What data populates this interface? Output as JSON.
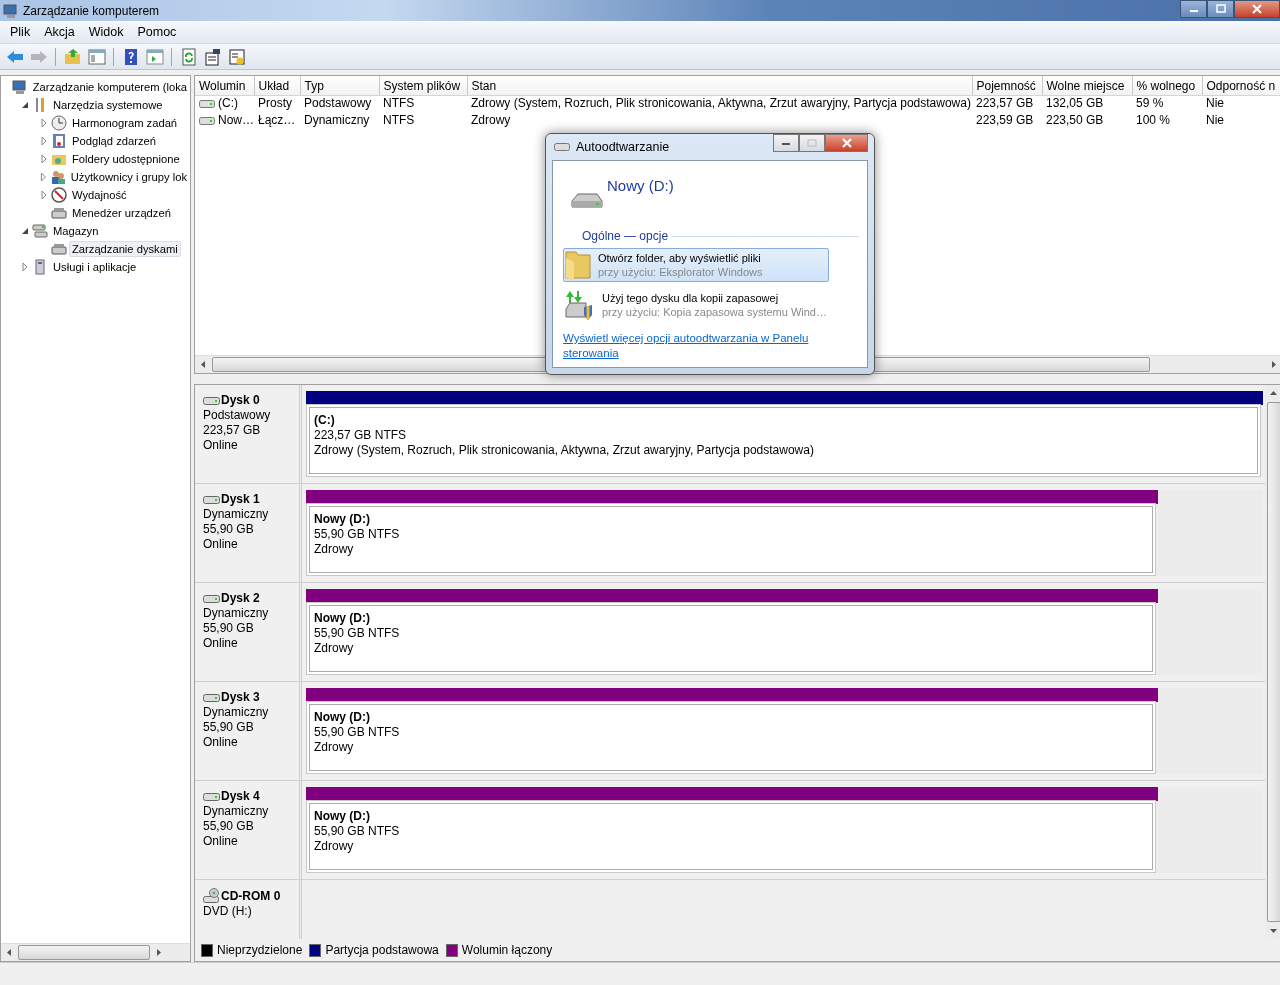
{
  "window": {
    "title": "Zarządzanie komputerem"
  },
  "menu": [
    "Plik",
    "Akcja",
    "Widok",
    "Pomoc"
  ],
  "toolbar": [
    {
      "kind": "back",
      "disabled": false
    },
    {
      "kind": "forward",
      "disabled": true
    },
    {
      "kind": "sep"
    },
    {
      "kind": "up",
      "disabled": false
    },
    {
      "kind": "tree",
      "disabled": false
    },
    {
      "kind": "sep"
    },
    {
      "kind": "help",
      "disabled": false
    },
    {
      "kind": "pane",
      "disabled": false
    },
    {
      "kind": "sep"
    },
    {
      "kind": "refresh",
      "disabled": false
    },
    {
      "kind": "props",
      "disabled": false
    },
    {
      "kind": "wizard",
      "disabled": false
    }
  ],
  "tree": [
    {
      "label": "Zarządzanie komputerem (loka",
      "kind": "computer",
      "selected": false,
      "children": [
        {
          "label": "Narzędzia systemowe",
          "kind": "tools",
          "expanded": true,
          "selected": false,
          "children": [
            {
              "label": "Harmonogram zadań",
              "kind": "clock",
              "expanded": false,
              "selected": false
            },
            {
              "label": "Podgląd zdarzeń",
              "kind": "log",
              "expanded": false,
              "selected": false
            },
            {
              "label": "Foldery udostępnione",
              "kind": "folder",
              "expanded": false,
              "selected": false
            },
            {
              "label": "Użytkownicy i grupy lok",
              "kind": "users",
              "expanded": false,
              "selected": false
            },
            {
              "label": "Wydajność",
              "kind": "perf",
              "expanded": false,
              "selected": false
            },
            {
              "label": "Menedżer urządzeń",
              "kind": "device",
              "selected": false
            }
          ]
        },
        {
          "label": "Magazyn",
          "kind": "storage",
          "expanded": true,
          "selected": false,
          "children": [
            {
              "label": "Zarządzanie dyskami",
              "kind": "device",
              "selected": true
            }
          ]
        },
        {
          "label": "Usługi i aplikacje",
          "kind": "services",
          "expanded": false,
          "selected": false
        }
      ]
    }
  ],
  "table": {
    "columns": [
      "Wolumin",
      "Układ",
      "Typ",
      "System plików",
      "Stan",
      "Pojemność",
      "Wolne miejsce",
      "% wolnego",
      "Odporność n"
    ],
    "rows": [
      [
        "(C:)",
        "Prosty",
        "Podstawowy",
        "NTFS",
        "Zdrowy (System, Rozruch, Plik stronicowania, Aktywna, Zrzut awaryjny, Partycja podstawowa)",
        "223,57 GB",
        "132,05 GB",
        "59 %",
        "Nie"
      ],
      [
        "Now…",
        "Łącz…",
        "Dynamiczny",
        "NTFS",
        "Zdrowy",
        "223,59 GB",
        "223,50 GB",
        "100 %",
        "Nie"
      ]
    ]
  },
  "disks": [
    {
      "kind": "disk",
      "name": "Dysk 0",
      "lines": [
        "Podstawowy",
        "223,57 GB",
        "Online"
      ],
      "partitions": [
        {
          "label": "(C:)",
          "size": "223,57 GB NTFS",
          "status": "Zdrowy (System, Rozruch, Plik stronicowania, Aktywna, Zrzut awaryjny, Partycja podstawowa)",
          "color": "#000080",
          "level": 1
        }
      ]
    },
    {
      "kind": "disk",
      "name": "Dysk 1",
      "lines": [
        "Dynamiczny",
        "55,90 GB",
        "Online"
      ],
      "partitions": [
        {
          "label": "Nowy  (D:)",
          "size": "55,90 GB NTFS",
          "status": "Zdrowy",
          "color": "#800080",
          "level": 0.89
        }
      ]
    },
    {
      "kind": "disk",
      "name": "Dysk 2",
      "lines": [
        "Dynamiczny",
        "55,90 GB",
        "Online"
      ],
      "partitions": [
        {
          "label": "Nowy  (D:)",
          "size": "55,90 GB NTFS",
          "status": "Zdrowy",
          "color": "#800080",
          "level": 0.89
        }
      ]
    },
    {
      "kind": "disk",
      "name": "Dysk 3",
      "lines": [
        "Dynamiczny",
        "55,90 GB",
        "Online"
      ],
      "partitions": [
        {
          "label": "Nowy  (D:)",
          "size": "55,90 GB NTFS",
          "status": "Zdrowy",
          "color": "#800080",
          "level": 0.89
        }
      ]
    },
    {
      "kind": "disk",
      "name": "Dysk 4",
      "lines": [
        "Dynamiczny",
        "55,90 GB",
        "Online"
      ],
      "partitions": [
        {
          "label": "Nowy  (D:)",
          "size": "55,90 GB NTFS",
          "status": "Zdrowy",
          "color": "#800080",
          "level": 0.89
        }
      ]
    },
    {
      "kind": "cdrom",
      "name": "CD-ROM 0",
      "lines": [
        "DVD (H:)"
      ]
    }
  ],
  "legend": [
    {
      "label": "Nieprzydzielone",
      "color": "#000000"
    },
    {
      "label": "Partycja podstawowa",
      "color": "#000080"
    },
    {
      "label": "Wolumin łączony",
      "color": "#800080"
    }
  ],
  "dialog": {
    "title": "Autoodtwarzanie",
    "heading": "Nowy (D:)",
    "section": "Ogólne — opcje",
    "options": [
      {
        "kind": "folder",
        "title": "Otwórz folder, aby wyświetlić pliki",
        "subtitle": "przy użyciu: Eksplorator Windows",
        "selected": true
      },
      {
        "kind": "backup",
        "title": "Użyj tego dysku dla kopii zapasowej",
        "subtitle": "przy użyciu: Kopia zapasowa systemu Wind…",
        "selected": false
      }
    ],
    "link": "Wyświetl więcej opcji autoodtwarzania w Panelu sterowania"
  }
}
